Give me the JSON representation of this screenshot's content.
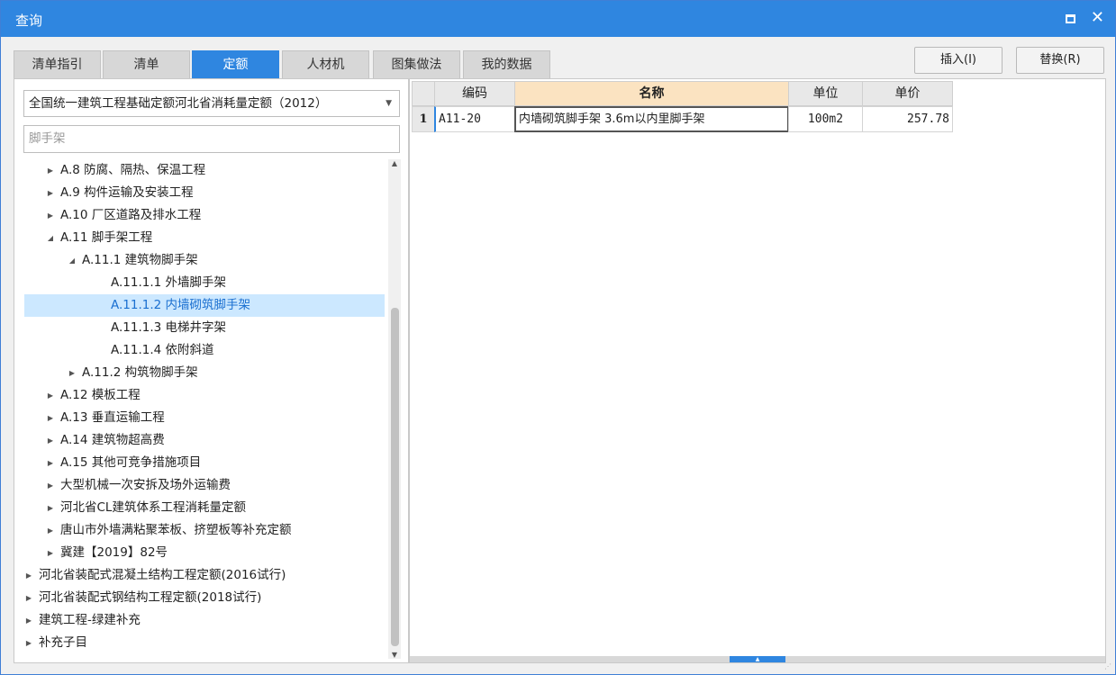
{
  "window": {
    "title": "查询"
  },
  "tabs": [
    {
      "label": "清单指引",
      "active": false
    },
    {
      "label": "清单",
      "active": false
    },
    {
      "label": "定额",
      "active": true
    },
    {
      "label": "人材机",
      "active": false
    },
    {
      "label": "图集做法",
      "active": false
    },
    {
      "label": "我的数据",
      "active": false
    }
  ],
  "buttons": {
    "insert": "插入(I)",
    "replace": "替换(R)"
  },
  "left": {
    "library_select": "全国统一建筑工程基础定额河北省消耗量定额（2012）",
    "search_value": "脚手架",
    "tree": [
      {
        "label": "A.8 防腐、隔热、保温工程",
        "level": 1,
        "arrow": "collapsed"
      },
      {
        "label": "A.9 构件运输及安装工程",
        "level": 1,
        "arrow": "collapsed"
      },
      {
        "label": "A.10 厂区道路及排水工程",
        "level": 1,
        "arrow": "collapsed"
      },
      {
        "label": "A.11 脚手架工程",
        "level": 1,
        "arrow": "expanded"
      },
      {
        "label": "A.11.1 建筑物脚手架",
        "level": 2,
        "arrow": "expanded"
      },
      {
        "label": "A.11.1.1 外墙脚手架",
        "level": 3,
        "arrow": "none"
      },
      {
        "label": "A.11.1.2 内墙砌筑脚手架",
        "level": 3,
        "arrow": "none",
        "selected": true
      },
      {
        "label": "A.11.1.3 电梯井字架",
        "level": 3,
        "arrow": "none"
      },
      {
        "label": "A.11.1.4 依附斜道",
        "level": 3,
        "arrow": "none"
      },
      {
        "label": "A.11.2 构筑物脚手架",
        "level": 2,
        "arrow": "collapsed"
      },
      {
        "label": "A.12 模板工程",
        "level": 1,
        "arrow": "collapsed"
      },
      {
        "label": "A.13 垂直运输工程",
        "level": 1,
        "arrow": "collapsed"
      },
      {
        "label": "A.14 建筑物超高费",
        "level": 1,
        "arrow": "collapsed"
      },
      {
        "label": "A.15 其他可竞争措施项目",
        "level": 1,
        "arrow": "collapsed"
      },
      {
        "label": "大型机械一次安拆及场外运输费",
        "level": 1,
        "arrow": "collapsed"
      },
      {
        "label": "河北省CL建筑体系工程消耗量定额",
        "level": 1,
        "arrow": "collapsed"
      },
      {
        "label": "唐山市外墙满粘聚苯板、挤塑板等补充定额",
        "level": 1,
        "arrow": "collapsed"
      },
      {
        "label": "冀建【2019】82号",
        "level": 1,
        "arrow": "collapsed"
      },
      {
        "label": "河北省装配式混凝土结构工程定额(2016试行)",
        "level": 0,
        "arrow": "collapsed"
      },
      {
        "label": "河北省装配式钢结构工程定额(2018试行)",
        "level": 0,
        "arrow": "collapsed"
      },
      {
        "label": "建筑工程-绿建补充",
        "level": 0,
        "arrow": "collapsed"
      },
      {
        "label": "补充子目",
        "level": 0,
        "arrow": "collapsed"
      }
    ]
  },
  "grid": {
    "columns": [
      "编码",
      "名称",
      "单位",
      "单价"
    ],
    "rows": [
      {
        "index": "1",
        "code": "A11-20",
        "name": "内墙砌筑脚手架 3.6m以内里脚手架",
        "unit": "100m2",
        "price": "257.78"
      }
    ]
  }
}
